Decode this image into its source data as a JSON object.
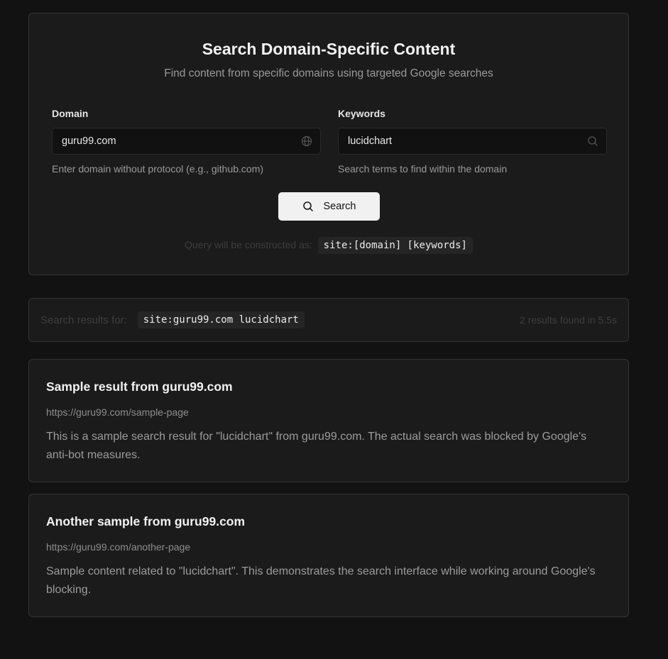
{
  "search_form": {
    "title": "Search Domain-Specific Content",
    "subtitle": "Find content from specific domains using targeted Google searches",
    "domain": {
      "label": "Domain",
      "value": "guru99.com",
      "help": "Enter domain without protocol (e.g., github.com)",
      "icon": "globe-icon"
    },
    "keywords": {
      "label": "Keywords",
      "value": "lucidchart",
      "help": "Search terms to find within the domain",
      "icon": "search-icon"
    },
    "search_button": "Search",
    "query_hint_label": "Query will be constructed as:",
    "query_hint_code": "site:[domain] [keywords]"
  },
  "results_header": {
    "label": "Search results for:",
    "query": "site:guru99.com lucidchart",
    "meta": "2 results found in 5.5s"
  },
  "results": [
    {
      "title": "Sample result from guru99.com",
      "url": "https://guru99.com/sample-page",
      "description": "This is a sample search result for \"lucidchart\" from guru99.com. The actual search was blocked by Google's anti-bot measures."
    },
    {
      "title": "Another sample from guru99.com",
      "url": "https://guru99.com/another-page",
      "description": "Sample content related to \"lucidchart\". This demonstrates the search interface while working around Google's blocking."
    }
  ],
  "colors": {
    "background": "#121212",
    "card": "#1b1b1b",
    "border": "#333333",
    "button": "#f1f1f1"
  }
}
